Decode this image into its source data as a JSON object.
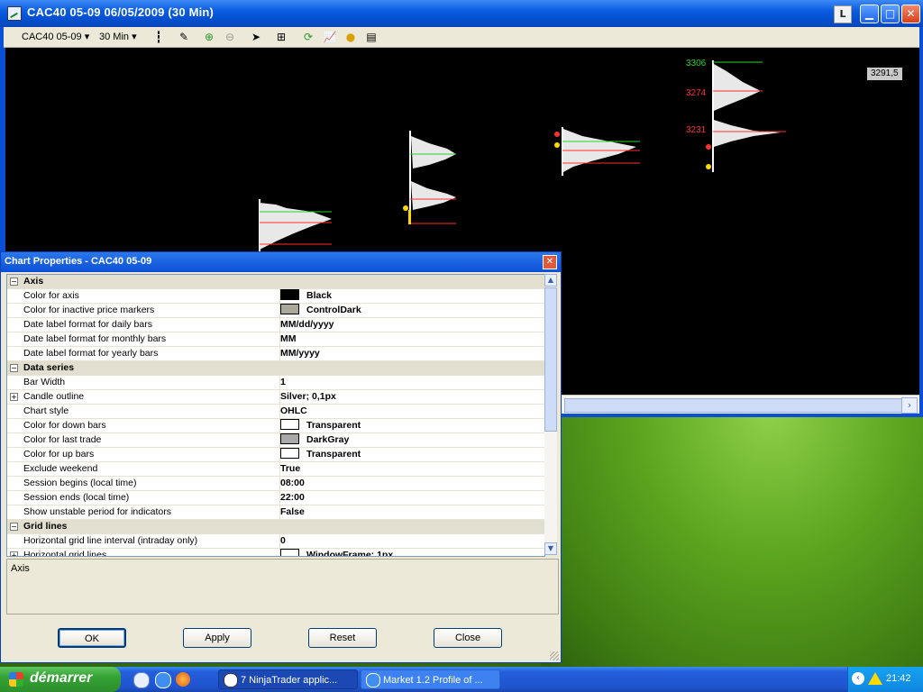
{
  "chart_window": {
    "title": "CAC40 05-09  06/05/2009 (30 Min)",
    "L_label": "L",
    "toolbar": {
      "instrument": "CAC40 05-09",
      "period": "30 Min"
    },
    "price_labels": {
      "p1": "3306",
      "p2": "3274",
      "p3": "3231",
      "last": "3291,5"
    },
    "colors": {
      "background": "#000000",
      "profile": "#ffffff",
      "poc": "#ff3030",
      "value_area": "#2bd42b"
    }
  },
  "dialog": {
    "title": "Chart Properties - CAC40 05-09",
    "rows": [
      {
        "type": "category",
        "label": "Axis",
        "expander": "−"
      },
      {
        "label": "Color for axis",
        "value": "Black",
        "swatch": "#000000"
      },
      {
        "label": "Color for inactive price markers",
        "value": "ControlDark",
        "swatch": "#aca899"
      },
      {
        "label": "Date label format for daily bars",
        "value": "MM/dd/yyyy"
      },
      {
        "label": "Date label format for monthly bars",
        "value": "MM"
      },
      {
        "label": "Date label format for yearly bars",
        "value": "MM/yyyy"
      },
      {
        "type": "category",
        "label": "Data series",
        "expander": "−"
      },
      {
        "label": "Bar Width",
        "value": "1"
      },
      {
        "label": "Candle outline",
        "value": "Silver; 0,1px",
        "expander": "+"
      },
      {
        "label": "Chart style",
        "value": "OHLC"
      },
      {
        "label": "Color for down bars",
        "value": "Transparent",
        "swatch": "#ffffff"
      },
      {
        "label": "Color for last trade",
        "value": "DarkGray",
        "swatch": "#a9a9a9"
      },
      {
        "label": "Color for up bars",
        "value": "Transparent",
        "swatch": "#ffffff"
      },
      {
        "label": "Exclude weekend",
        "value": "True"
      },
      {
        "label": "Session begins (local time)",
        "value": "08:00"
      },
      {
        "label": "Session ends (local time)",
        "value": "22:00"
      },
      {
        "label": "Show unstable period for indicators",
        "value": "False"
      },
      {
        "type": "category",
        "label": "Grid lines",
        "expander": "−"
      },
      {
        "label": "Horizontal grid line  interval (intraday only)",
        "value": "0"
      },
      {
        "label": "Horizontal grid lines",
        "value": "WindowFrame; 1px",
        "swatch": "#ffffff",
        "expander": "+"
      }
    ],
    "description": "Axis",
    "buttons": {
      "ok": "OK",
      "apply": "Apply",
      "reset": "Reset",
      "close": "Close"
    }
  },
  "taskbar": {
    "start_label": "démarrer",
    "tasks": [
      {
        "label": "7 NinjaTrader applic...",
        "active": true
      },
      {
        "label": "Market 1.2 Profile of ...",
        "active": false
      }
    ],
    "clock": "21:42"
  }
}
